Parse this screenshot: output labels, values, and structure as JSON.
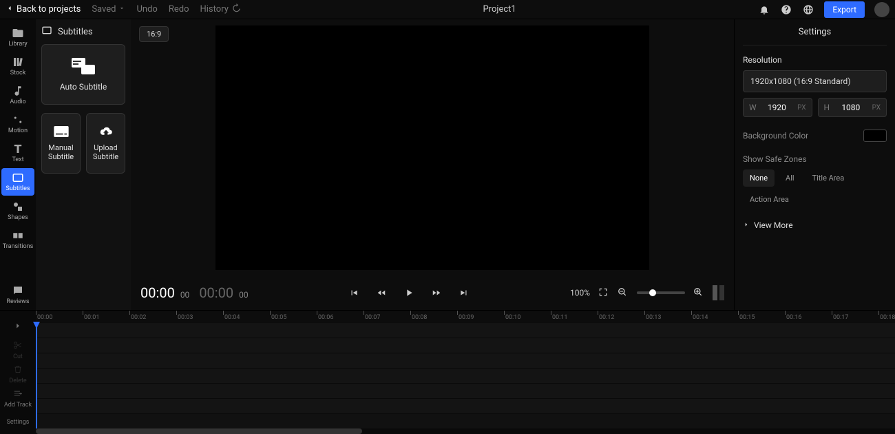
{
  "topbar": {
    "back": "Back to projects",
    "saved": "Saved",
    "undo": "Undo",
    "redo": "Redo",
    "history": "History",
    "project_name": "Project1",
    "export": "Export"
  },
  "rail": {
    "items": [
      {
        "label": "Library"
      },
      {
        "label": "Stock"
      },
      {
        "label": "Audio"
      },
      {
        "label": "Motion"
      },
      {
        "label": "Text"
      },
      {
        "label": "Subtitles"
      },
      {
        "label": "Shapes"
      },
      {
        "label": "Transitions"
      }
    ],
    "reviews": "Reviews"
  },
  "panel": {
    "title": "Subtitles",
    "auto": "Auto Subtitle",
    "manual": "Manual Subtitle",
    "upload": "Upload Subtitle"
  },
  "preview": {
    "aspect": "16:9",
    "time_current": "00:00",
    "time_current_frames": "00",
    "time_total": "00:00",
    "time_total_frames": "00",
    "zoom_pct": "100%"
  },
  "settings": {
    "title": "Settings",
    "resolution_label": "Resolution",
    "resolution_value": "1920x1080 (16:9 Standard)",
    "width_label": "W",
    "width_value": "1920",
    "height_label": "H",
    "height_value": "1080",
    "px_unit": "PX",
    "bg_label": "Background Color",
    "bg_value": "#000000",
    "safe_label": "Show Safe Zones",
    "safe_options": [
      "None",
      "All",
      "Title Area",
      "Action Area"
    ],
    "view_more": "View More"
  },
  "timeline": {
    "tools": {
      "cut": "Cut",
      "delete": "Delete",
      "add_track": "Add Track",
      "settings": "Settings"
    },
    "marks": [
      "00:00",
      "00:01",
      "00:02",
      "00:03",
      "00:04",
      "00:05",
      "00:06",
      "00:07",
      "00:08",
      "00:09",
      "00:10",
      "00:11",
      "00:12",
      "00:13",
      "00:14",
      "00:15",
      "00:16",
      "00:17",
      "00:18"
    ]
  }
}
